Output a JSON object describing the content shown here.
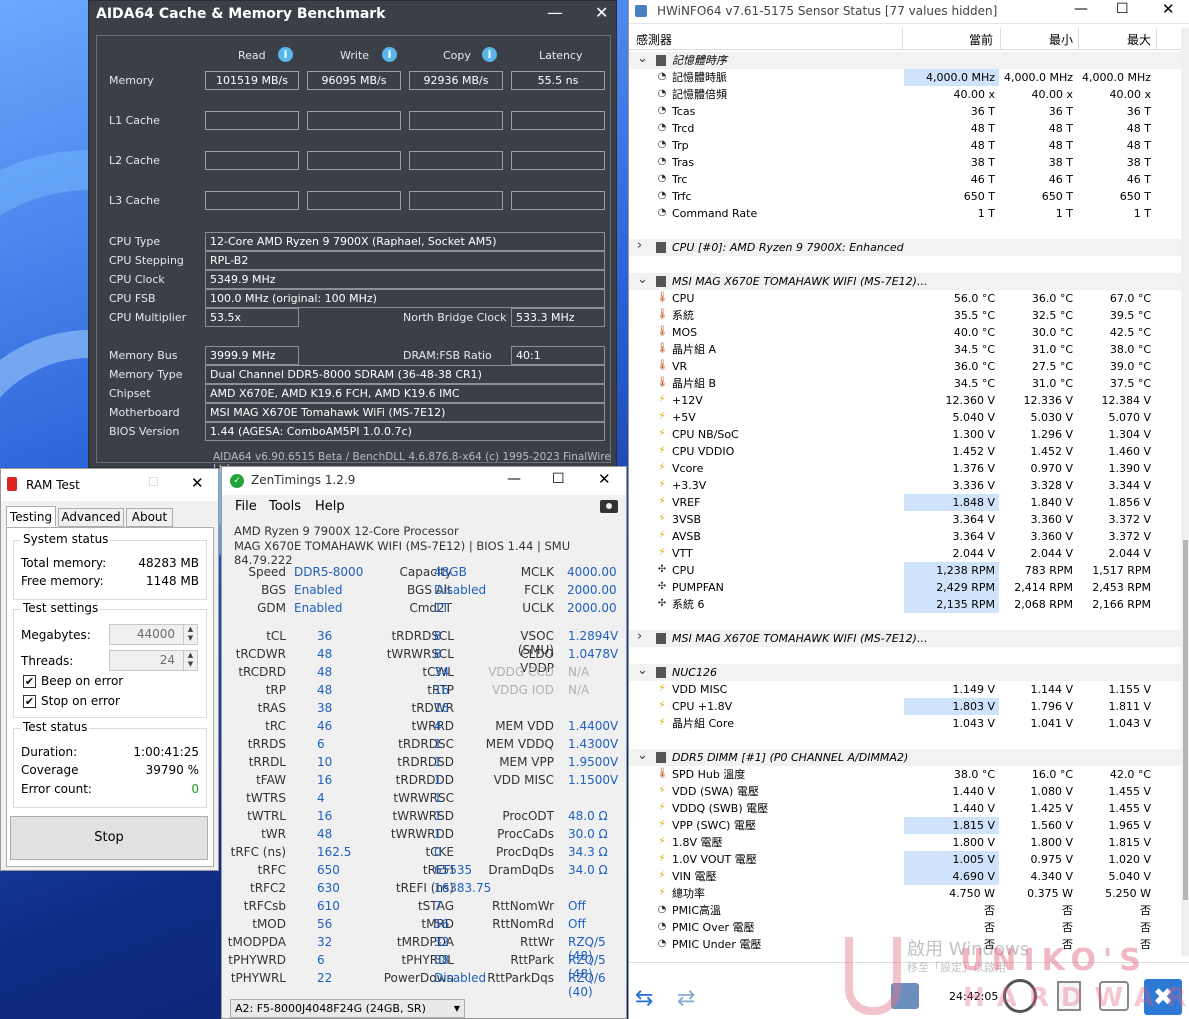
{
  "aida": {
    "title": "AIDA64 Cache & Memory Benchmark",
    "minimize": "—",
    "close": "✕",
    "col_read": "Read",
    "col_write": "Write",
    "col_copy": "Copy",
    "col_latency": "Latency",
    "rows": {
      "memory": {
        "label": "Memory",
        "read": "101519 MB/s",
        "write": "96095 MB/s",
        "copy": "92936 MB/s",
        "latency": "55.5 ns"
      },
      "l1": {
        "label": "L1 Cache"
      },
      "l2": {
        "label": "L2 Cache"
      },
      "l3": {
        "label": "L3 Cache"
      }
    },
    "cpu_type_label": "CPU Type",
    "cpu_type": "12-Core AMD Ryzen 9 7900X  (Raphael, Socket AM5)",
    "cpu_stepping_label": "CPU Stepping",
    "cpu_stepping": "RPL-B2",
    "cpu_clock_label": "CPU Clock",
    "cpu_clock": "5349.9 MHz",
    "cpu_fsb_label": "CPU FSB",
    "cpu_fsb": "100.0 MHz  (original: 100 MHz)",
    "cpu_mult_label": "CPU Multiplier",
    "cpu_mult": "53.5x",
    "nb_clock_label": "North Bridge Clock",
    "nb_clock": "533.3 MHz",
    "mem_bus_label": "Memory Bus",
    "mem_bus": "3999.9 MHz",
    "dram_ratio_label": "DRAM:FSB Ratio",
    "dram_ratio": "40:1",
    "mem_type_label": "Memory Type",
    "mem_type": "Dual Channel DDR5-8000 SDRAM  (36-48-38 CR1)",
    "chipset_label": "Chipset",
    "chipset": "AMD X670E, AMD K19.6 FCH, AMD K19.6 IMC",
    "mobo_label": "Motherboard",
    "mobo": "MSI MAG X670E Tomahawk WiFi (MS-7E12)",
    "bios_label": "BIOS Version",
    "bios": "1.44  (AGESA: ComboAM5PI 1.0.0.7c)",
    "footer": "AIDA64 v6.90.6515 Beta / BenchDLL 4.6.876.8-x64  (c) 1995-2023 FinalWire Ltd."
  },
  "ramtest": {
    "title": "RAM Test",
    "tabs": [
      "Testing",
      "Advanced",
      "About"
    ],
    "system_status": "System status",
    "total_memory_label": "Total memory:",
    "total_memory": "48283 MB",
    "free_memory_label": "Free memory:",
    "free_memory": "1148 MB",
    "test_settings": "Test settings",
    "megabytes_label": "Megabytes:",
    "megabytes": "44000",
    "threads_label": "Threads:",
    "threads": "24",
    "beep_label": "Beep on error",
    "stop_on_error_label": "Stop on error",
    "test_status": "Test status",
    "duration_label": "Duration:",
    "duration": "1:00:41:25",
    "coverage_label": "Coverage",
    "coverage": "39790 %",
    "errors_label": "Error count:",
    "errors": "0",
    "stop_button": "Stop"
  },
  "zen": {
    "title": "ZenTimings 1.2.9",
    "menu": [
      "File",
      "Tools",
      "Help"
    ],
    "cpu": "AMD Ryzen 9 7900X 12-Core Processor",
    "board": "MAG X670E TOMAHAWK WIFI (MS-7E12) | BIOS 1.44 | SMU 84.79.222",
    "top": [
      [
        "Speed",
        "DDR5-8000",
        "Capacity",
        "48GB",
        "MCLK",
        "4000.00"
      ],
      [
        "BGS",
        "Enabled",
        "BGS Alt",
        "Disabled",
        "FCLK",
        "2000.00"
      ],
      [
        "GDM",
        "Enabled",
        "Cmd2T",
        "1T",
        "UCLK",
        "2000.00"
      ]
    ],
    "grid": [
      [
        "tCL",
        "36",
        "tRDRDSCL",
        "8",
        "VSOC (SMU)",
        "1.2894V"
      ],
      [
        "tRCDWR",
        "48",
        "tWRWRSCL",
        "8",
        "CLDO VDDP",
        "1.0478V"
      ],
      [
        "tRCDRD",
        "48",
        "tCWL",
        "34",
        "VDDG CCD",
        "N/A"
      ],
      [
        "tRP",
        "48",
        "tRTP",
        "16",
        "VDDG IOD",
        "N/A"
      ],
      [
        "tRAS",
        "38",
        "tRDWR",
        "16",
        "",
        ""
      ],
      [
        "tRC",
        "46",
        "tWRRD",
        "4",
        "MEM VDD",
        "1.4400V"
      ],
      [
        "tRRDS",
        "6",
        "tRDRDSC",
        "1",
        "MEM VDDQ",
        "1.4300V"
      ],
      [
        "tRRDL",
        "10",
        "tRDRDSD",
        "1",
        "MEM VPP",
        "1.9500V"
      ],
      [
        "tFAW",
        "16",
        "tRDRDDD",
        "1",
        "VDD MISC",
        "1.1500V"
      ],
      [
        "tWTRS",
        "4",
        "tWRWRSC",
        "1",
        "",
        ""
      ],
      [
        "tWTRL",
        "16",
        "tWRWRSD",
        "1",
        "ProcODT",
        "48.0 Ω"
      ],
      [
        "tWR",
        "48",
        "tWRWRDD",
        "1",
        "ProcCaDs",
        "30.0 Ω"
      ],
      [
        "tRFC (ns)",
        "162.5",
        "tCKE",
        "0",
        "ProcDqDs",
        "34.3 Ω"
      ],
      [
        "tRFC",
        "650",
        "tREFI",
        "65535",
        "DramDqDs",
        "34.0 Ω"
      ],
      [
        "tRFC2",
        "630",
        "tREFI (ns)",
        "16383.75",
        "",
        ""
      ],
      [
        "tRFCsb",
        "610",
        "tSTAG",
        "7",
        "RttNomWr",
        "Off"
      ],
      [
        "tMOD",
        "56",
        "tMRD",
        "56",
        "RttNomRd",
        "Off"
      ],
      [
        "tMODPDA",
        "32",
        "tMRDPDA",
        "32",
        "RttWr",
        "RZQ/5 (48)"
      ],
      [
        "tPHYWRD",
        "6",
        "tPHYRDL",
        "38",
        "RttPark",
        "RZQ/5 (48)"
      ],
      [
        "tPHYWRL",
        "22",
        "PowerDown",
        "Disabled",
        "RttParkDqs",
        "RZQ/6 (40)"
      ]
    ],
    "module": "A2: F5-8000J4048F24G (24GB, SR)"
  },
  "hwinfo": {
    "title": "HWiNFO64 v7.61-5175 Sensor Status [77 values hidden]",
    "col_sensor": "感測器",
    "col_current": "當前",
    "col_min": "最小",
    "col_max": "最大",
    "rows": [
      {
        "t": "g",
        "exp": "v",
        "name": "記憶體時序"
      },
      {
        "t": "s",
        "ic": "clk",
        "name": "記憶體時脈",
        "c": "4,000.0 MHz",
        "mn": "4,000.0 MHz",
        "mx": "4,000.0 MHz",
        "hl": true
      },
      {
        "t": "s",
        "ic": "clk",
        "name": "記憶體倍頻",
        "c": "40.00 x",
        "mn": "40.00 x",
        "mx": "40.00 x"
      },
      {
        "t": "s",
        "ic": "clk",
        "name": "Tcas",
        "c": "36 T",
        "mn": "36 T",
        "mx": "36 T"
      },
      {
        "t": "s",
        "ic": "clk",
        "name": "Trcd",
        "c": "48 T",
        "mn": "48 T",
        "mx": "48 T"
      },
      {
        "t": "s",
        "ic": "clk",
        "name": "Trp",
        "c": "48 T",
        "mn": "48 T",
        "mx": "48 T"
      },
      {
        "t": "s",
        "ic": "clk",
        "name": "Tras",
        "c": "38 T",
        "mn": "38 T",
        "mx": "38 T"
      },
      {
        "t": "s",
        "ic": "clk",
        "name": "Trc",
        "c": "46 T",
        "mn": "46 T",
        "mx": "46 T"
      },
      {
        "t": "s",
        "ic": "clk",
        "name": "Trfc",
        "c": "650 T",
        "mn": "650 T",
        "mx": "650 T"
      },
      {
        "t": "s",
        "ic": "clk",
        "name": "Command Rate",
        "c": "1 T",
        "mn": "1 T",
        "mx": "1 T"
      },
      {
        "t": "b"
      },
      {
        "t": "g",
        "exp": ">",
        "name": "CPU [#0]: AMD Ryzen 9 7900X: Enhanced"
      },
      {
        "t": "b"
      },
      {
        "t": "g",
        "exp": "v",
        "name": "MSI MAG X670E TOMAHAWK WIFI (MS-7E12)..."
      },
      {
        "t": "s",
        "ic": "tmp",
        "name": "CPU",
        "c": "56.0 °C",
        "mn": "36.0 °C",
        "mx": "67.0 °C"
      },
      {
        "t": "s",
        "ic": "tmp",
        "name": "系統",
        "c": "35.5 °C",
        "mn": "32.5 °C",
        "mx": "39.5 °C"
      },
      {
        "t": "s",
        "ic": "tmp",
        "name": "MOS",
        "c": "40.0 °C",
        "mn": "30.0 °C",
        "mx": "42.5 °C"
      },
      {
        "t": "s",
        "ic": "tmp",
        "name": "晶片組 A",
        "c": "34.5 °C",
        "mn": "31.0 °C",
        "mx": "38.0 °C"
      },
      {
        "t": "s",
        "ic": "tmp",
        "name": "VR",
        "c": "36.0 °C",
        "mn": "27.5 °C",
        "mx": "39.0 °C"
      },
      {
        "t": "s",
        "ic": "tmp",
        "name": "晶片組 B",
        "c": "34.5 °C",
        "mn": "31.0 °C",
        "mx": "37.5 °C"
      },
      {
        "t": "s",
        "ic": "vlt",
        "name": "+12V",
        "c": "12.360 V",
        "mn": "12.336 V",
        "mx": "12.384 V"
      },
      {
        "t": "s",
        "ic": "vlt",
        "name": "+5V",
        "c": "5.040 V",
        "mn": "5.030 V",
        "mx": "5.070 V"
      },
      {
        "t": "s",
        "ic": "vlt",
        "name": "CPU NB/SoC",
        "c": "1.300 V",
        "mn": "1.296 V",
        "mx": "1.304 V"
      },
      {
        "t": "s",
        "ic": "vlt",
        "name": "CPU VDDIO",
        "c": "1.452 V",
        "mn": "1.452 V",
        "mx": "1.460 V"
      },
      {
        "t": "s",
        "ic": "vlt",
        "name": "Vcore",
        "c": "1.376 V",
        "mn": "0.970 V",
        "mx": "1.390 V"
      },
      {
        "t": "s",
        "ic": "vlt",
        "name": "+3.3V",
        "c": "3.336 V",
        "mn": "3.328 V",
        "mx": "3.344 V"
      },
      {
        "t": "s",
        "ic": "vlt",
        "name": "VREF",
        "c": "1.848 V",
        "mn": "1.840 V",
        "mx": "1.856 V",
        "hl": true
      },
      {
        "t": "s",
        "ic": "vlt",
        "name": "3VSB",
        "c": "3.364 V",
        "mn": "3.360 V",
        "mx": "3.372 V"
      },
      {
        "t": "s",
        "ic": "vlt",
        "name": "AVSB",
        "c": "3.364 V",
        "mn": "3.360 V",
        "mx": "3.372 V"
      },
      {
        "t": "s",
        "ic": "vlt",
        "name": "VTT",
        "c": "2.044 V",
        "mn": "2.044 V",
        "mx": "2.044 V"
      },
      {
        "t": "s",
        "ic": "fan",
        "name": "CPU",
        "c": "1,238 RPM",
        "mn": "783 RPM",
        "mx": "1,517 RPM",
        "hl": true
      },
      {
        "t": "s",
        "ic": "fan",
        "name": "PUMPFAN",
        "c": "2,429 RPM",
        "mn": "2,414 RPM",
        "mx": "2,453 RPM",
        "hl": true
      },
      {
        "t": "s",
        "ic": "fan",
        "name": "系統 6",
        "c": "2,135 RPM",
        "mn": "2,068 RPM",
        "mx": "2,166 RPM",
        "hl": true
      },
      {
        "t": "b"
      },
      {
        "t": "g",
        "exp": ">",
        "name": "MSI MAG X670E TOMAHAWK WIFI (MS-7E12)..."
      },
      {
        "t": "b"
      },
      {
        "t": "g",
        "exp": "v",
        "name": "NUC126"
      },
      {
        "t": "s",
        "ic": "vlt",
        "name": "VDD MISC",
        "c": "1.149 V",
        "mn": "1.144 V",
        "mx": "1.155 V"
      },
      {
        "t": "s",
        "ic": "vlt",
        "name": "CPU +1.8V",
        "c": "1.803 V",
        "mn": "1.796 V",
        "mx": "1.811 V",
        "hl": true
      },
      {
        "t": "s",
        "ic": "vlt",
        "name": "晶片組 Core",
        "c": "1.043 V",
        "mn": "1.041 V",
        "mx": "1.043 V"
      },
      {
        "t": "b"
      },
      {
        "t": "g",
        "exp": "v",
        "name": "DDR5 DIMM [#1] (P0 CHANNEL A/DIMMA2)"
      },
      {
        "t": "s",
        "ic": "tmp",
        "name": "SPD Hub 溫度",
        "c": "38.0 °C",
        "mn": "16.0 °C",
        "mx": "42.0 °C"
      },
      {
        "t": "s",
        "ic": "vlt",
        "name": "VDD (SWA) 電壓",
        "c": "1.440 V",
        "mn": "1.080 V",
        "mx": "1.455 V"
      },
      {
        "t": "s",
        "ic": "vlt",
        "name": "VDDQ (SWB) 電壓",
        "c": "1.440 V",
        "mn": "1.425 V",
        "mx": "1.455 V"
      },
      {
        "t": "s",
        "ic": "vlt",
        "name": "VPP (SWC) 電壓",
        "c": "1.815 V",
        "mn": "1.560 V",
        "mx": "1.965 V",
        "hl": true
      },
      {
        "t": "s",
        "ic": "vlt",
        "name": "1.8V 電壓",
        "c": "1.800 V",
        "mn": "1.800 V",
        "mx": "1.815 V"
      },
      {
        "t": "s",
        "ic": "vlt",
        "name": "1.0V VOUT 電壓",
        "c": "1.005 V",
        "mn": "0.975 V",
        "mx": "1.020 V",
        "hl": true
      },
      {
        "t": "s",
        "ic": "vlt",
        "name": "VIN 電壓",
        "c": "4.690 V",
        "mn": "4.340 V",
        "mx": "5.040 V",
        "hl": true
      },
      {
        "t": "s",
        "ic": "vlt",
        "name": "總功率",
        "c": "4.750 W",
        "mn": "0.375 W",
        "mx": "5.250 W"
      },
      {
        "t": "s",
        "ic": "clk",
        "name": "PMIC高溫",
        "c": "否",
        "mn": "否",
        "mx": "否"
      },
      {
        "t": "s",
        "ic": "clk",
        "name": "PMIC Over 電壓",
        "c": "否",
        "mn": "否",
        "mx": "否"
      },
      {
        "t": "s",
        "ic": "clk",
        "name": "PMIC Under 電壓",
        "c": "否",
        "mn": "否",
        "mx": "否"
      }
    ],
    "clock": "24:42:05"
  },
  "watermark": {
    "activate": "啟用 Windows",
    "activate2": "移至「設定」以啟用",
    "brand": "UNIKO'S",
    "brand2": "HARDWARE"
  }
}
